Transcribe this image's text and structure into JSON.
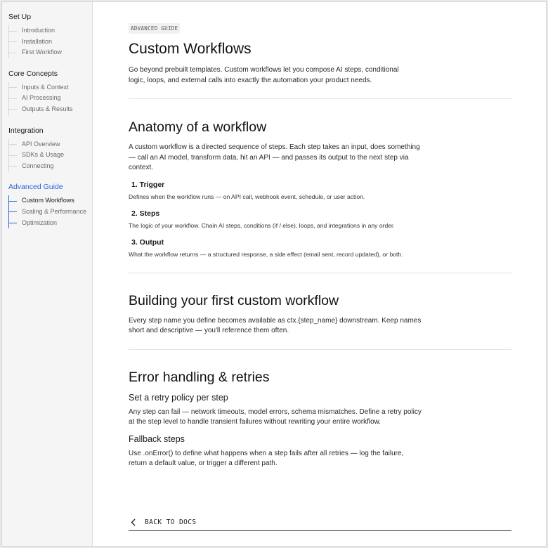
{
  "sidebar": {
    "groups": [
      {
        "title": "Set Up",
        "items": [
          "Introduction",
          "Installation",
          "First Workflow"
        ]
      },
      {
        "title": "Core Concepts",
        "items": [
          "Inputs & Context",
          "AI Processing",
          "Outputs & Results"
        ]
      },
      {
        "title": "Integration",
        "items": [
          "API Overview",
          "SDKs & Usage",
          "Connecting"
        ]
      },
      {
        "title": "Advanced Guide",
        "items": [
          "Custom Workflows",
          "Scaling & Performance",
          "Optimization"
        ]
      }
    ],
    "active_group": "Advanced Guide",
    "current_item": "Custom Workflows"
  },
  "page": {
    "eyebrow": "ADVANCED GUIDE",
    "title": "Custom Workflows",
    "lead": "Go beyond prebuilt templates. Custom workflows let you compose AI steps, conditional logic, loops, and external calls into exactly the automation your product needs."
  },
  "anatomy": {
    "heading": "Anatomy of a workflow",
    "intro": "A custom workflow is a directed sequence of steps. Each step takes an input, does something — call an AI model, transform data, hit an API — and passes its output to the next step via context.",
    "steps": [
      {
        "title": "1.  Trigger",
        "desc": "Defines when the workflow runs — on API call, webhook event, schedule, or user action."
      },
      {
        "title": "2.  Steps",
        "desc": "The logic of your workflow. Chain AI steps, conditions (if / else), loops, and integrations in any order."
      },
      {
        "title": "3.  Output",
        "desc": "What the workflow returns — a structured response, a side effect (email sent, record updated), or both."
      }
    ]
  },
  "building": {
    "heading": "Building your first custom workflow",
    "text": "Every step name you define becomes available as ctx.{step_name} downstream. Keep names short and descriptive — you'll reference them often."
  },
  "errors": {
    "heading": "Error handling & retries",
    "retry_title": "Set a retry policy per step",
    "retry_text": "Any step can fail — network timeouts, model errors, schema mismatches. Define a retry policy at the step level to handle transient failures without rewriting your entire workflow.",
    "fallback_title": "Fallback steps",
    "fallback_text": "Use .onError() to define what happens when a step fails after all retries — log the failure, return a default value, or trigger a different path."
  },
  "footer": {
    "back_label": "BACK TO DOCS"
  },
  "colors": {
    "accent": "#2a66d4",
    "sidebar_bg": "#f5f5f5"
  }
}
